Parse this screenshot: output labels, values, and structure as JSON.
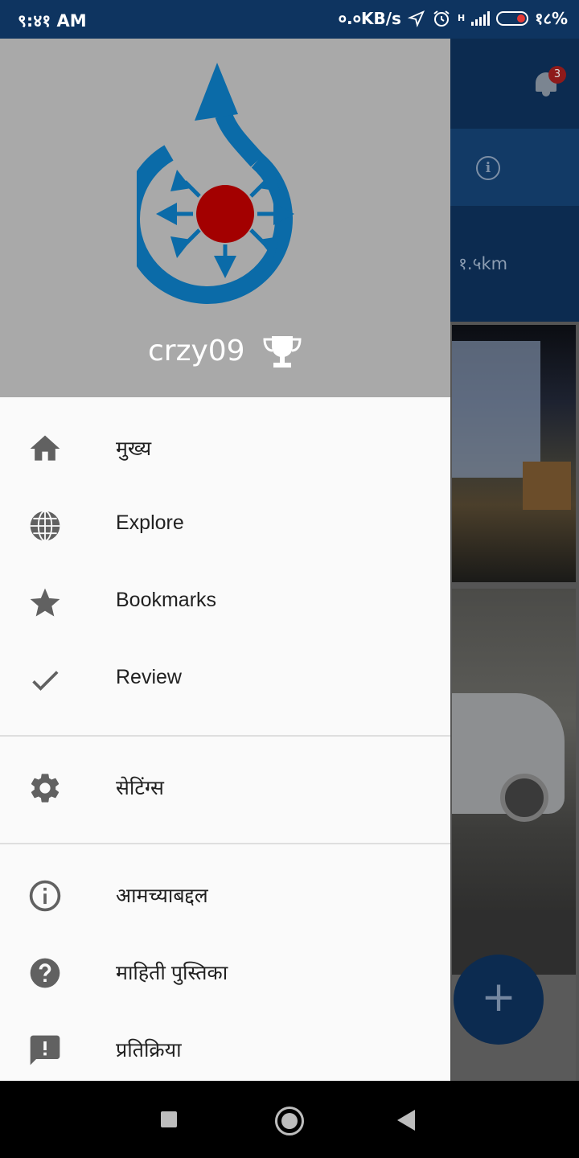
{
  "status_bar": {
    "time": "९:४१ AM",
    "speed": "०.०KB/s",
    "network": "H",
    "battery": "१८%"
  },
  "background_app": {
    "notification_count": "3",
    "distance": "१.५km",
    "fab_label": "+"
  },
  "drawer": {
    "username": "crzy09",
    "menu_primary": [
      {
        "label": "मुख्य",
        "icon": "home-icon"
      },
      {
        "label": "Explore",
        "icon": "globe-icon"
      },
      {
        "label": "Bookmarks",
        "icon": "star-icon"
      },
      {
        "label": "Review",
        "icon": "check-icon"
      }
    ],
    "menu_secondary": [
      {
        "label": "सेटिंग्स",
        "icon": "gear-icon"
      }
    ],
    "menu_tertiary": [
      {
        "label": "आमच्याबद्दल",
        "icon": "info-icon"
      },
      {
        "label": "माहिती पुस्तिका",
        "icon": "help-icon"
      },
      {
        "label": "प्रतिक्रिया",
        "icon": "feedback-icon"
      }
    ]
  },
  "colors": {
    "status_bar": "#0e3460",
    "drawer_header": "#a9a9a9",
    "logo_blue": "#0b6ba8",
    "logo_red": "#a30000",
    "icon_gray": "#616161"
  }
}
